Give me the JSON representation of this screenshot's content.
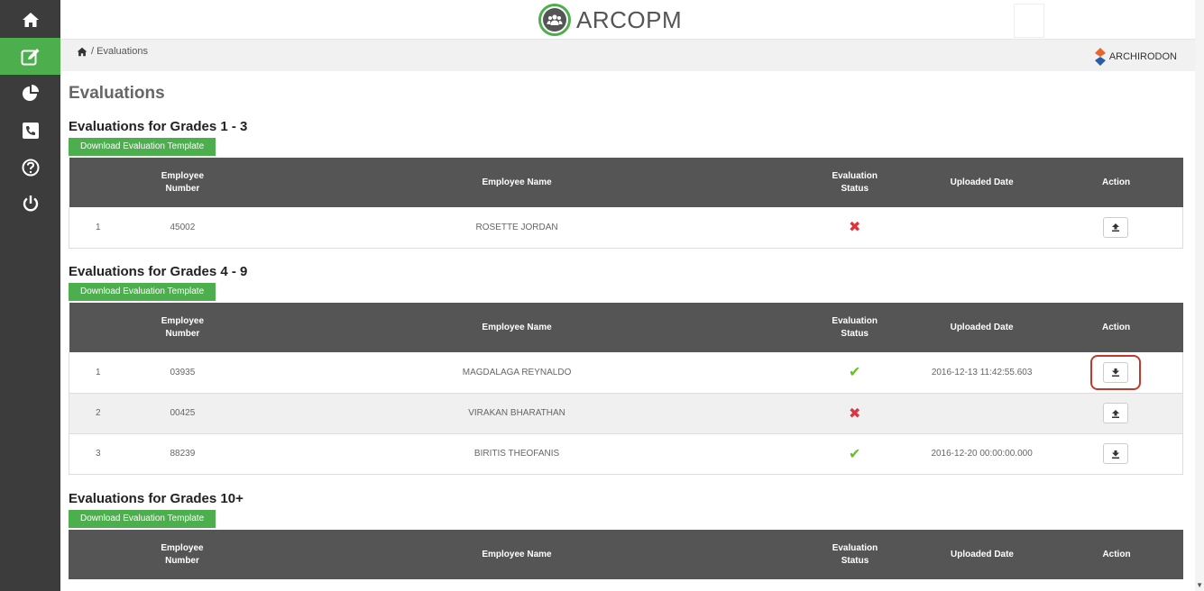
{
  "app": {
    "title": "ARCOPM",
    "brand": "ARCHIRODON"
  },
  "sidebar": {
    "items": [
      {
        "name": "home",
        "icon": "home-icon"
      },
      {
        "name": "evaluations",
        "icon": "edit-icon",
        "active": true
      },
      {
        "name": "reports",
        "icon": "pie-chart-icon"
      },
      {
        "name": "contact",
        "icon": "phone-icon"
      },
      {
        "name": "help",
        "icon": "help-icon"
      },
      {
        "name": "logout",
        "icon": "power-icon"
      }
    ]
  },
  "breadcrumb": {
    "path": "/ Evaluations"
  },
  "page": {
    "title": "Evaluations"
  },
  "columns": {
    "number": "Employee Number",
    "number_l1": "Employee",
    "number_l2": "Number",
    "name": "Employee Name",
    "status_l1": "Evaluation",
    "status_l2": "Status",
    "date": "Uploaded Date",
    "action": "Action"
  },
  "download_label": "Download Evaluation Template",
  "sections": [
    {
      "title": "Evaluations for Grades 1 - 3",
      "rows": [
        {
          "idx": "1",
          "number": "45002",
          "name": "ROSETTE JORDAN",
          "status": "missing",
          "date": ""
        }
      ]
    },
    {
      "title": "Evaluations for Grades 4 - 9",
      "rows": [
        {
          "idx": "1",
          "number": "03935",
          "name": "MAGDALAGA REYNALDO",
          "status": "uploaded",
          "date": "2016-12-13 11:42:55.603"
        },
        {
          "idx": "2",
          "number": "00425",
          "name": "VIRAKAN BHARATHAN",
          "status": "missing",
          "date": ""
        },
        {
          "idx": "3",
          "number": "88239",
          "name": "BIRITIS THEOFANIS",
          "status": "uploaded",
          "date": "2016-12-20 00:00:00.000"
        }
      ]
    },
    {
      "title": "Evaluations for Grades 10+",
      "rows": []
    }
  ],
  "colors": {
    "accent": "#4cae4c",
    "sidebar": "#3c3c3c",
    "header": "#555555",
    "error": "#d9363e",
    "success": "#6cbf2a",
    "highlight": "#c0392b"
  }
}
